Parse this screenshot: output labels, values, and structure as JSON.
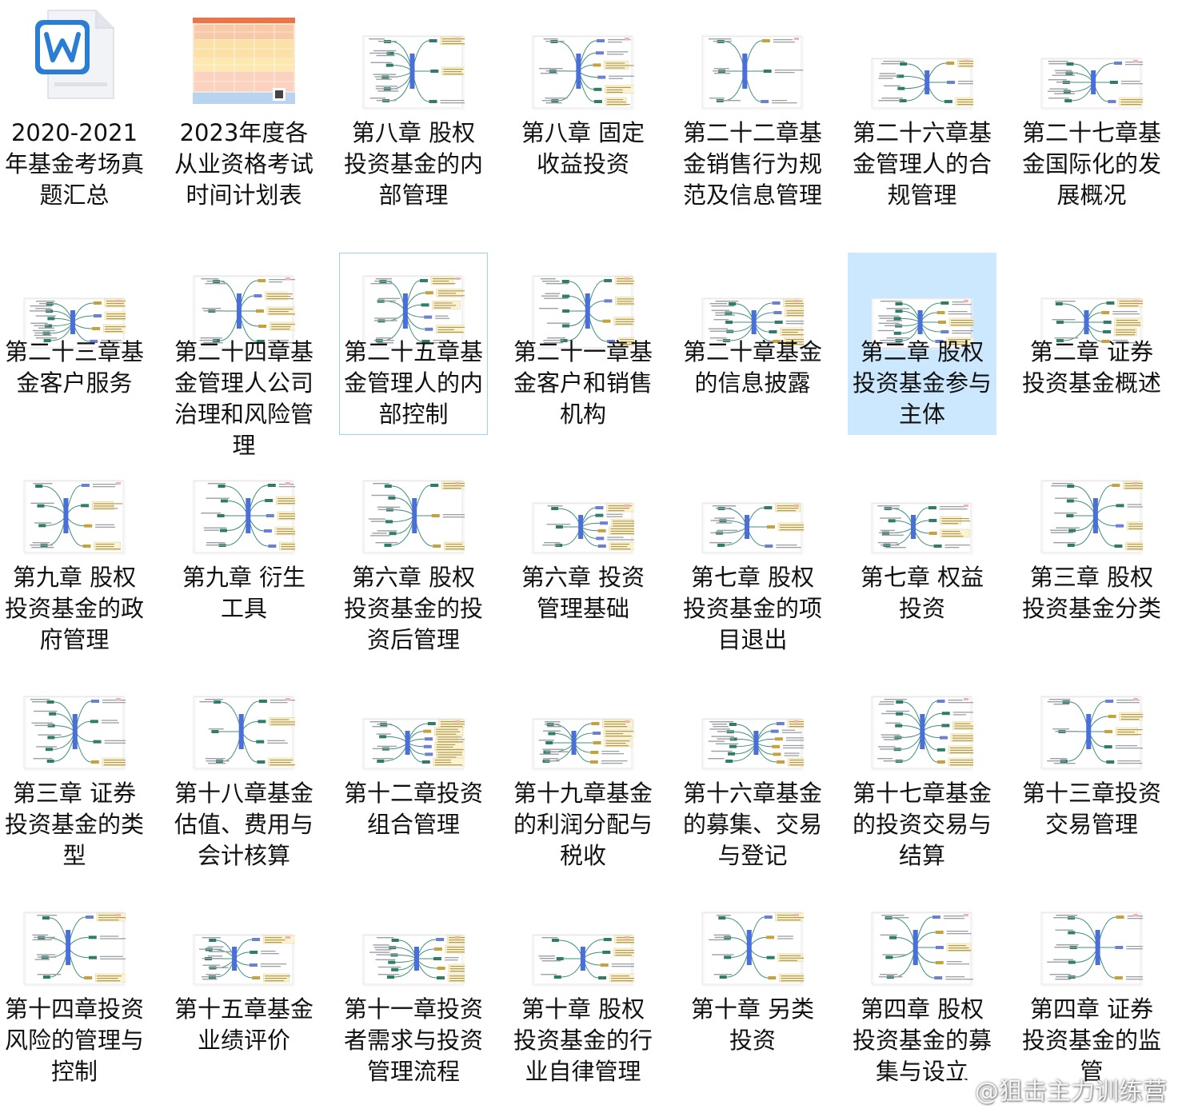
{
  "files": [
    {
      "name": "2020-2021年基金考场真题汇总",
      "type": "word",
      "icon": "word-document-icon"
    },
    {
      "name": "2023年度各从业资格考试时间计划表",
      "type": "schedule-image",
      "icon": "spreadsheet-thumbnail-icon"
    },
    {
      "name": "第八章  股权投资基金的内部管理",
      "type": "mindmap",
      "icon": "mindmap-thumbnail-icon"
    },
    {
      "name": "第八章  固定收益投资",
      "type": "mindmap",
      "icon": "mindmap-thumbnail-icon"
    },
    {
      "name": "第二十二章基金销售行为规范及信息管理",
      "type": "mindmap",
      "icon": "mindmap-thumbnail-icon"
    },
    {
      "name": "第二十六章基金管理人的合规管理",
      "type": "mindmap",
      "icon": "mindmap-thumbnail-icon"
    },
    {
      "name": "第二十七章基金国际化的发展概况",
      "type": "mindmap",
      "icon": "mindmap-thumbnail-icon"
    },
    {
      "name": "第二十三章基金客户服务",
      "type": "mindmap",
      "icon": "mindmap-thumbnail-icon"
    },
    {
      "name": "第二十四章基金管理人公司治理和风险管理",
      "type": "mindmap",
      "icon": "mindmap-thumbnail-icon"
    },
    {
      "name": "第二十五章基金管理人的内部控制",
      "type": "mindmap",
      "icon": "mindmap-thumbnail-icon",
      "state": "hover"
    },
    {
      "name": "第二十一章基金客户和销售机构",
      "type": "mindmap",
      "icon": "mindmap-thumbnail-icon"
    },
    {
      "name": "第二十章基金的信息披露",
      "type": "mindmap",
      "icon": "mindmap-thumbnail-icon"
    },
    {
      "name": "第二章  股权投资基金参与主体",
      "type": "mindmap",
      "icon": "mindmap-thumbnail-icon",
      "state": "selected"
    },
    {
      "name": "第二章 证券投资基金概述",
      "type": "mindmap",
      "icon": "mindmap-thumbnail-icon"
    },
    {
      "name": "第九章  股权投资基金的政府管理",
      "type": "mindmap",
      "icon": "mindmap-thumbnail-icon"
    },
    {
      "name": "第九章 衍生工具",
      "type": "mindmap",
      "icon": "mindmap-thumbnail-icon"
    },
    {
      "name": "第六章  股权投资基金的投资后管理",
      "type": "mindmap",
      "icon": "mindmap-thumbnail-icon"
    },
    {
      "name": "第六章 投资管理基础",
      "type": "mindmap",
      "icon": "mindmap-thumbnail-icon"
    },
    {
      "name": "第七章  股权投资基金的项目退出",
      "type": "mindmap",
      "icon": "mindmap-thumbnail-icon"
    },
    {
      "name": "第七章 权益投资",
      "type": "mindmap",
      "icon": "mindmap-thumbnail-icon"
    },
    {
      "name": "第三章 股权投资基金分类",
      "type": "mindmap",
      "icon": "mindmap-thumbnail-icon"
    },
    {
      "name": "第三章 证券投资基金的类型",
      "type": "mindmap",
      "icon": "mindmap-thumbnail-icon"
    },
    {
      "name": "第十八章基金估值、费用与会计核算",
      "type": "mindmap",
      "icon": "mindmap-thumbnail-icon"
    },
    {
      "name": "第十二章投资组合管理",
      "type": "mindmap",
      "icon": "mindmap-thumbnail-icon"
    },
    {
      "name": "第十九章基金的利润分配与税收",
      "type": "mindmap",
      "icon": "mindmap-thumbnail-icon"
    },
    {
      "name": "第十六章基金的募集、交易与登记",
      "type": "mindmap",
      "icon": "mindmap-thumbnail-icon"
    },
    {
      "name": "第十七章基金的投资交易与结算",
      "type": "mindmap",
      "icon": "mindmap-thumbnail-icon"
    },
    {
      "name": "第十三章投资交易管理",
      "type": "mindmap",
      "icon": "mindmap-thumbnail-icon"
    },
    {
      "name": "第十四章投资风险的管理与控制",
      "type": "mindmap",
      "icon": "mindmap-thumbnail-icon"
    },
    {
      "name": "第十五章基金业绩评价",
      "type": "mindmap",
      "icon": "mindmap-thumbnail-icon"
    },
    {
      "name": "第十一章投资者需求与投资管理流程",
      "type": "mindmap",
      "icon": "mindmap-thumbnail-icon"
    },
    {
      "name": "第十章  股权投资基金的行业自律管理",
      "type": "mindmap",
      "icon": "mindmap-thumbnail-icon"
    },
    {
      "name": "第十章  另类投资",
      "type": "mindmap",
      "icon": "mindmap-thumbnail-icon"
    },
    {
      "name": "第四章 股权投资基金的募集与设立",
      "type": "mindmap",
      "icon": "mindmap-thumbnail-icon"
    },
    {
      "name": "第四章 证券投资基金的监管",
      "type": "mindmap",
      "icon": "mindmap-thumbnail-icon"
    }
  ],
  "watermark": {
    "text": "@狙击主力训练营",
    "icon": "weibo-logo-icon"
  },
  "colors": {
    "selected_bg": "#cce8ff",
    "hover_border": "#99d1ff",
    "word_blue": "#2b7cd3",
    "mindmap_center": "#4a6fd8"
  }
}
